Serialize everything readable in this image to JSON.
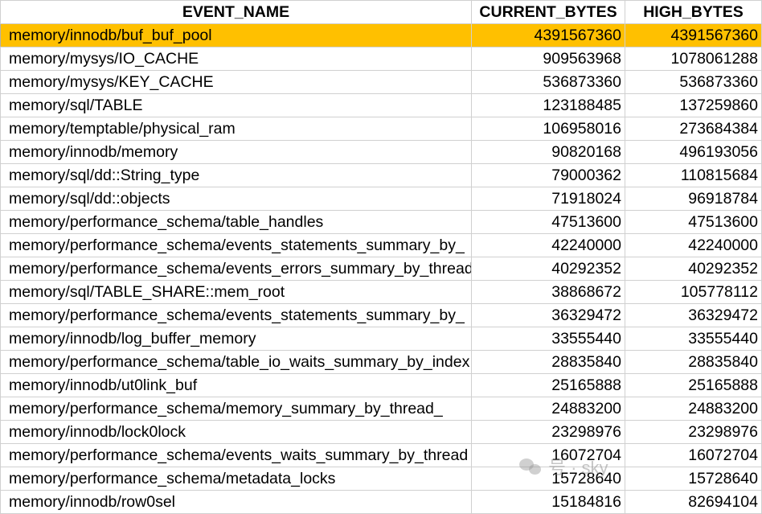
{
  "columns": {
    "event_name": "EVENT_NAME",
    "current_bytes": "CURRENT_BYTES",
    "high_bytes": "HIGH_BYTES"
  },
  "highlight_color": "#ffc000",
  "rows": [
    {
      "name": "memory/innodb/buf_buf_pool",
      "current": "4391567360",
      "high": "4391567360",
      "highlighted": true
    },
    {
      "name": "memory/mysys/IO_CACHE",
      "current": "909563968",
      "high": "1078061288"
    },
    {
      "name": "memory/mysys/KEY_CACHE",
      "current": "536873360",
      "high": "536873360"
    },
    {
      "name": "memory/sql/TABLE",
      "current": "123188485",
      "high": "137259860"
    },
    {
      "name": "memory/temptable/physical_ram",
      "current": "106958016",
      "high": "273684384"
    },
    {
      "name": "memory/innodb/memory",
      "current": "90820168",
      "high": "496193056"
    },
    {
      "name": "memory/sql/dd::String_type",
      "current": "79000362",
      "high": "110815684"
    },
    {
      "name": "memory/sql/dd::objects",
      "current": "71918024",
      "high": "96918784"
    },
    {
      "name": "memory/performance_schema/table_handles",
      "current": "47513600",
      "high": "47513600"
    },
    {
      "name": "memory/performance_schema/events_statements_summary_by_",
      "current": "42240000",
      "high": "42240000"
    },
    {
      "name": "memory/performance_schema/events_errors_summary_by_thread",
      "current": "40292352",
      "high": "40292352"
    },
    {
      "name": "memory/sql/TABLE_SHARE::mem_root",
      "current": "38868672",
      "high": "105778112"
    },
    {
      "name": "memory/performance_schema/events_statements_summary_by_",
      "current": "36329472",
      "high": "36329472"
    },
    {
      "name": "memory/innodb/log_buffer_memory",
      "current": "33555440",
      "high": "33555440"
    },
    {
      "name": "memory/performance_schema/table_io_waits_summary_by_index",
      "current": "28835840",
      "high": "28835840"
    },
    {
      "name": "memory/innodb/ut0link_buf",
      "current": "25165888",
      "high": "25165888"
    },
    {
      "name": "memory/performance_schema/memory_summary_by_thread_",
      "current": "24883200",
      "high": "24883200"
    },
    {
      "name": "memory/innodb/lock0lock",
      "current": "23298976",
      "high": "23298976"
    },
    {
      "name": "memory/performance_schema/events_waits_summary_by_thread",
      "current": "16072704",
      "high": "16072704"
    },
    {
      "name": "memory/performance_schema/metadata_locks",
      "current": "15728640",
      "high": "15728640"
    },
    {
      "name": "memory/innodb/row0sel",
      "current": "15184816",
      "high": "82694104"
    }
  ],
  "watermark": {
    "text": "号 · sky",
    "icon": "chat-bubbles-icon"
  }
}
